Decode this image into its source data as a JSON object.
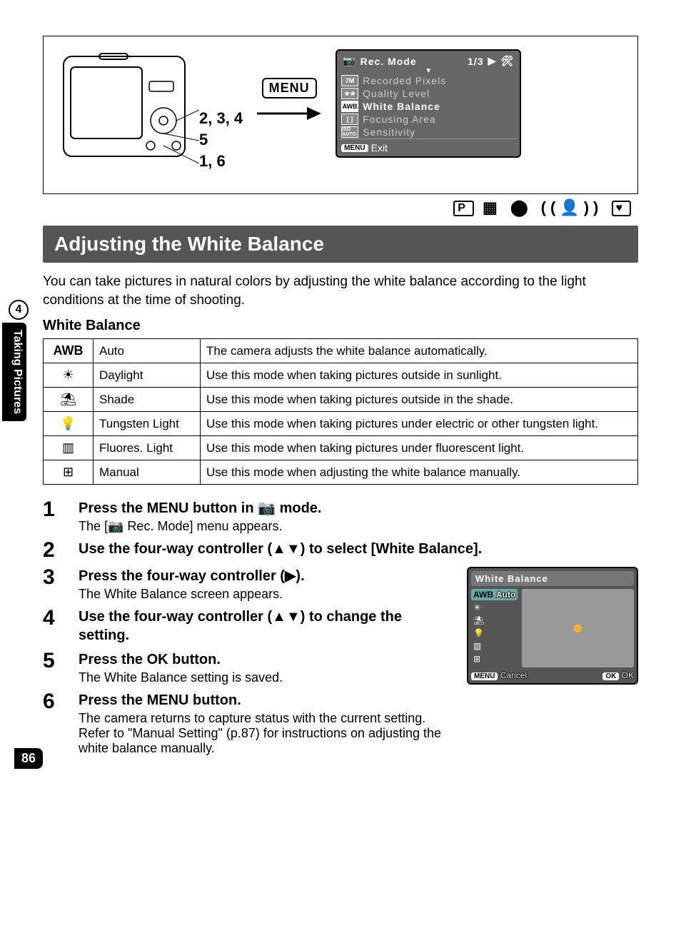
{
  "side": {
    "chapter_number": "4",
    "chapter_label": "Taking Pictures"
  },
  "page_number": "86",
  "diagram": {
    "labels": {
      "line1": "2, 3, 4",
      "line2": "5",
      "line3": "1, 6"
    },
    "menu_badge": "MENU"
  },
  "lcd_menu": {
    "title": "Rec. Mode",
    "page_indicator": "1/3",
    "rows": [
      {
        "icon": "7M",
        "label": "Recorded Pixels"
      },
      {
        "icon": "★★",
        "label": "Quality Level"
      },
      {
        "icon": "AWB",
        "label": "White Balance"
      },
      {
        "icon": "[ ]",
        "label": "Focusing Area"
      },
      {
        "icon": "ISO AUTO",
        "label": "Sensitivity"
      }
    ],
    "footer_badge": "MENU",
    "footer_label": "Exit"
  },
  "mode_strip": {
    "icons": "P  ▦  ⬤  ((👤))  ♥"
  },
  "section_title": "Adjusting the White Balance",
  "intro": "You can take pictures in natural colors by adjusting the white balance according to the light conditions at the time of shooting.",
  "table_heading": "White Balance",
  "wb_table": [
    {
      "icon": "AWB",
      "name": "Auto",
      "desc": "The camera adjusts the white balance automatically."
    },
    {
      "icon": "☀",
      "name": "Daylight",
      "desc": "Use this mode when taking pictures outside in sunlight."
    },
    {
      "icon": "⛱",
      "name": "Shade",
      "desc": "Use this mode when taking pictures outside in the shade."
    },
    {
      "icon": "💡",
      "name": "Tungsten Light",
      "desc": "Use this mode when taking pictures under electric or other tungsten light."
    },
    {
      "icon": "▥",
      "name": "Fluores. Light",
      "desc": "Use this mode when taking pictures under fluorescent light."
    },
    {
      "icon": "⊞",
      "name": "Manual",
      "desc": "Use this mode when adjusting the white balance manually."
    }
  ],
  "steps": [
    {
      "n": "1",
      "title": "Press the MENU button in 📷 mode.",
      "desc": "The [📷 Rec. Mode] menu appears."
    },
    {
      "n": "2",
      "title": "Use the four-way controller (▲▼) to select [White Balance].",
      "desc": ""
    },
    {
      "n": "3",
      "title": "Press the four-way controller (▶).",
      "desc": "The White Balance screen appears."
    },
    {
      "n": "4",
      "title": "Use the four-way controller (▲▼) to change the setting.",
      "desc": ""
    },
    {
      "n": "5",
      "title": "Press the OK button.",
      "desc": "The White Balance setting is saved."
    },
    {
      "n": "6",
      "title": "Press the MENU button.",
      "desc": "The camera returns to capture status with the current setting.\nRefer to \"Manual Setting\" (p.87) for instructions on adjusting the white balance manually."
    }
  ],
  "wb_screen": {
    "title": "White Balance",
    "options": [
      {
        "icon": "AWB",
        "label": "Auto"
      },
      {
        "icon": "☀",
        "label": ""
      },
      {
        "icon": "⛱",
        "label": ""
      },
      {
        "icon": "💡",
        "label": ""
      },
      {
        "icon": "▥",
        "label": ""
      },
      {
        "icon": "⊞",
        "label": ""
      }
    ],
    "footer_left_badge": "MENU",
    "footer_left": "Cancel",
    "footer_right_badge": "OK",
    "footer_right": "OK"
  }
}
